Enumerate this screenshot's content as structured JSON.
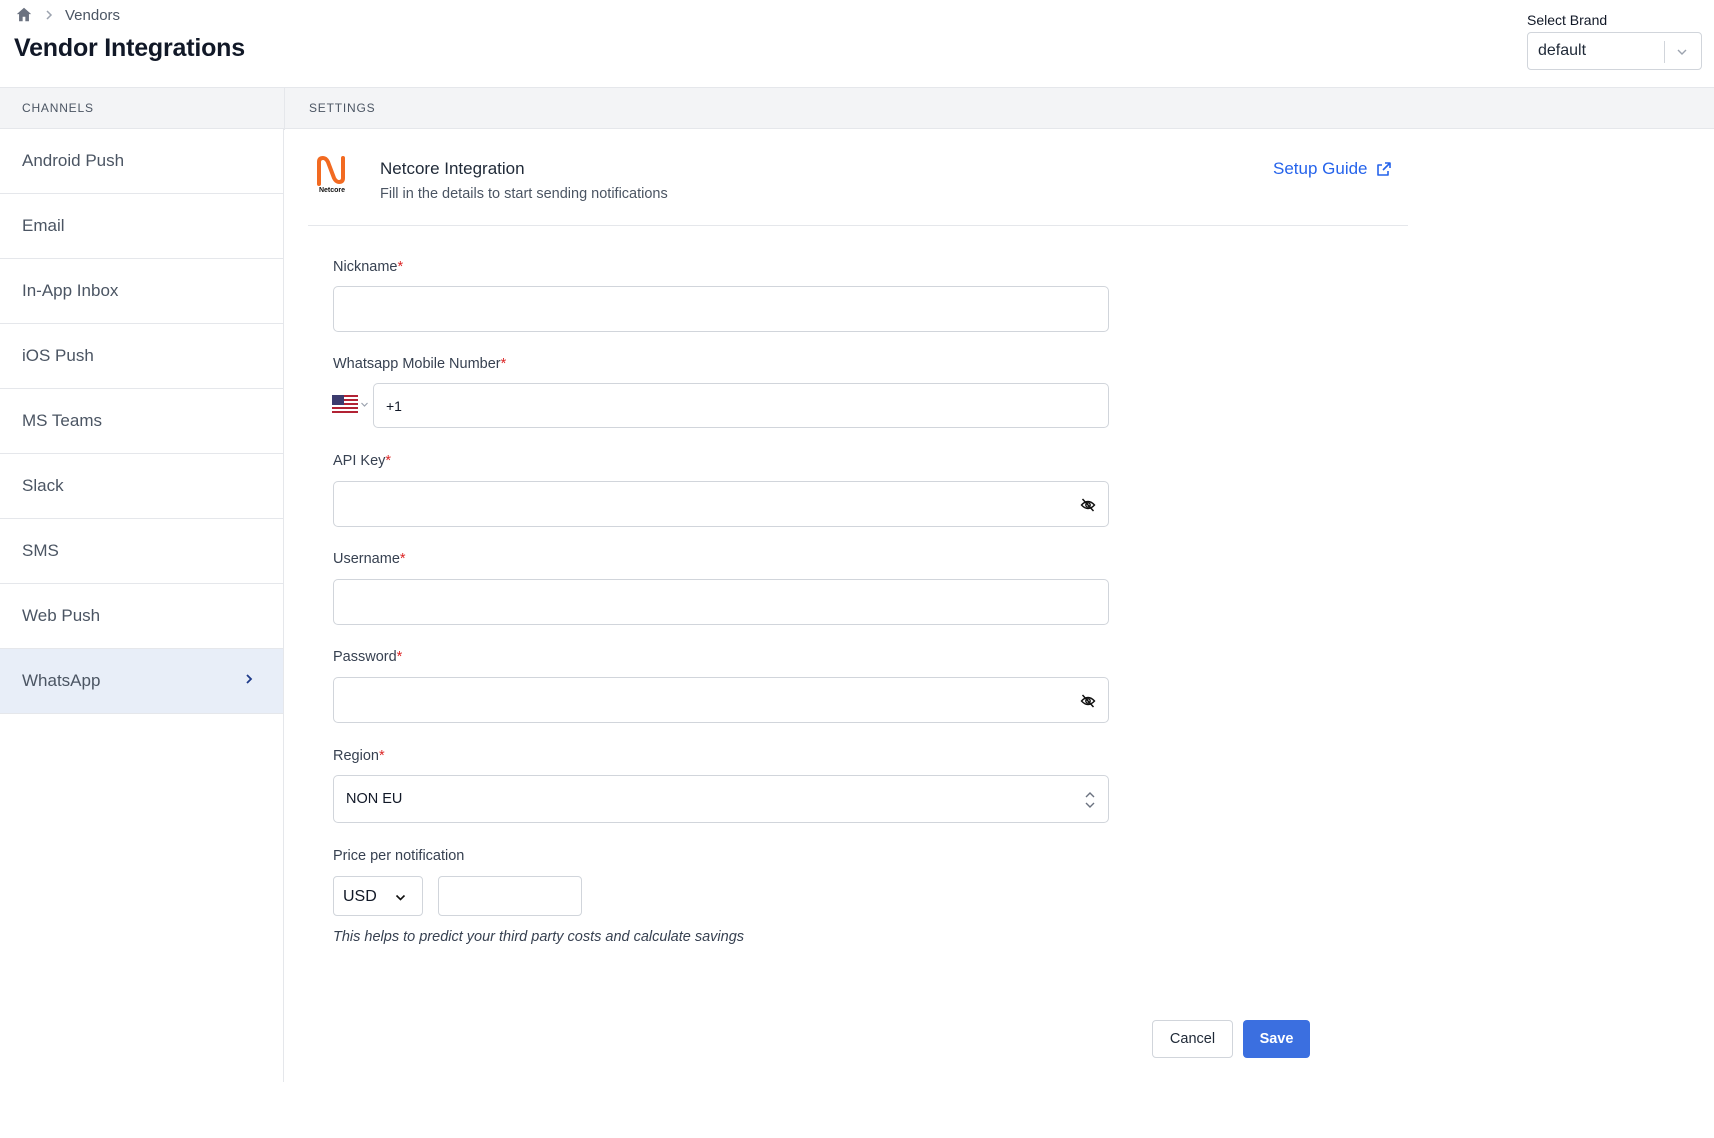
{
  "header": {
    "breadcrumb": [
      "Vendors"
    ],
    "title": "Vendor Integrations",
    "brand_label": "Select Brand",
    "brand_value": "default"
  },
  "columns": {
    "channels": "CHANNELS",
    "settings": "SETTINGS"
  },
  "sidebar": {
    "items": [
      {
        "label": "Android Push"
      },
      {
        "label": "Email"
      },
      {
        "label": "In-App Inbox"
      },
      {
        "label": "iOS Push"
      },
      {
        "label": "MS Teams"
      },
      {
        "label": "Slack"
      },
      {
        "label": "SMS"
      },
      {
        "label": "Web Push"
      },
      {
        "label": "WhatsApp"
      }
    ],
    "active": "WhatsApp"
  },
  "integration": {
    "logo_text": "Netcore",
    "title": "Netcore Integration",
    "subtitle": "Fill in the details to start sending notifications",
    "setup_guide": "Setup Guide"
  },
  "form": {
    "nickname_label": "Nickname",
    "nickname_value": "",
    "whatsapp_label": "Whatsapp Mobile Number",
    "phone_value": "+1",
    "country": "US",
    "api_key_label": "API Key",
    "username_label": "Username",
    "password_label": "Password",
    "region_label": "Region",
    "region_value": "NON EU",
    "price_label": "Price per notification",
    "currency_value": "USD",
    "price_value": "",
    "helper_text": "This helps to predict your third party costs and calculate savings",
    "required_mark": "*"
  },
  "actions": {
    "cancel": "Cancel",
    "save": "Save"
  },
  "colors": {
    "accent": "#3b6fe0",
    "link": "#2563eb",
    "required": "#dc2626",
    "active_bg": "#e8eef8",
    "netcore_orange": "#f26a21"
  }
}
